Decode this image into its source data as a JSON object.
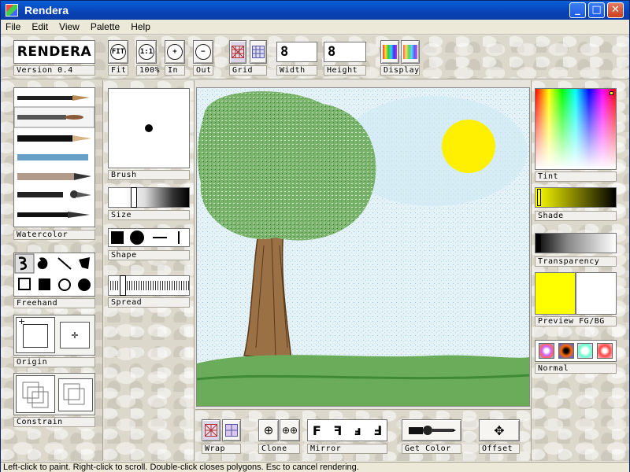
{
  "window": {
    "title": "Rendera",
    "minimize": "_",
    "maximize": "□",
    "close": "✕"
  },
  "menu": [
    "File",
    "Edit",
    "View",
    "Palette",
    "Help"
  ],
  "logo": {
    "name": "RENDERA",
    "version": "Version 0.4"
  },
  "toolbar": {
    "fit": "Fit",
    "zoom100": "100%",
    "zoom_in": "In",
    "zoom_out": "Out",
    "grid": "Grid",
    "width_label": "Width",
    "width_value": "8",
    "height_label": "Height",
    "height_value": "8",
    "display": "Display",
    "fit_icon": "FIT",
    "zoom100_icon": "1:1"
  },
  "left": {
    "brush_group": "Watercolor",
    "shape_group": "Freehand",
    "origin": "Origin",
    "constrain": "Constrain"
  },
  "brush_panel": {
    "brush": "Brush",
    "size": "Size",
    "shape": "Shape",
    "spread": "Spread"
  },
  "bottom": {
    "wrap": "Wrap",
    "clone": "Clone",
    "mirror": "Mirror",
    "mirror_glyphs": "F ꟻ ⅎ Ⅎ",
    "get_color": "Get Color",
    "offset": "Offset"
  },
  "right": {
    "tint": "Tint",
    "shade": "Shade",
    "transparency": "Transparency",
    "preview": "Preview FG/BG",
    "blend": "Normal"
  },
  "colors": {
    "fg": "#ffff00",
    "bg": "#ffffff",
    "sky": "#d8eef6",
    "sun": "#ffef00",
    "grass": "#5da04f",
    "trunk": "#8a6a3a"
  },
  "status": "Left-click to paint. Right-click to scroll. Double-click closes polygons. Esc to cancel rendering."
}
